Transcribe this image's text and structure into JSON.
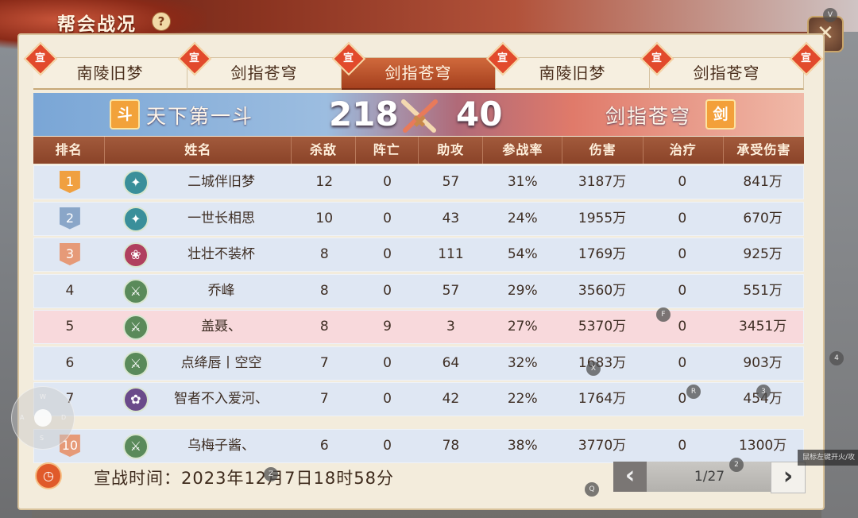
{
  "header": {
    "title": "帮会战况",
    "help_icon": "?",
    "close_icon": "✕"
  },
  "tabs": [
    {
      "label": "南陵旧梦",
      "badge": "宣",
      "active": false
    },
    {
      "label": "剑指苍穹",
      "badge": "宣",
      "active": false
    },
    {
      "label": "剑指苍穹",
      "badge": "宣",
      "active": true
    },
    {
      "label": "南陵旧梦",
      "badge": "宣",
      "active": false
    },
    {
      "label": "剑指苍穹",
      "badge": "宣",
      "active": false
    }
  ],
  "last_tab_badge": "宣",
  "score": {
    "left_icon": "斗",
    "left_name": "天下第一斗",
    "left_score": "218",
    "right_icon": "剑",
    "right_name": "剑指苍穹",
    "right_score": "40"
  },
  "table": {
    "headers": [
      "排名",
      "姓名",
      "杀敌",
      "阵亡",
      "助攻",
      "参战率",
      "伤害",
      "治疗",
      "承受伤害"
    ],
    "rows": [
      {
        "rank": "1",
        "cls": "teal",
        "name": "二城伴旧梦",
        "kills": "12",
        "deaths": "0",
        "assists": "57",
        "rate": "31%",
        "damage": "3187万",
        "heal": "0",
        "taken": "841万"
      },
      {
        "rank": "2",
        "cls": "teal",
        "name": "一世长相思",
        "kills": "10",
        "deaths": "0",
        "assists": "43",
        "rate": "24%",
        "damage": "1955万",
        "heal": "0",
        "taken": "670万"
      },
      {
        "rank": "3",
        "cls": "pink",
        "name": "壮壮不装杯",
        "kills": "8",
        "deaths": "0",
        "assists": "111",
        "rate": "54%",
        "damage": "1769万",
        "heal": "0",
        "taken": "925万"
      },
      {
        "rank": "4",
        "cls": "green",
        "name": "乔峰",
        "kills": "8",
        "deaths": "0",
        "assists": "57",
        "rate": "29%",
        "damage": "3560万",
        "heal": "0",
        "taken": "551万"
      },
      {
        "rank": "5",
        "cls": "green",
        "name": "盖聂、",
        "kills": "8",
        "deaths": "9",
        "assists": "3",
        "rate": "27%",
        "damage": "5370万",
        "heal": "0",
        "taken": "3451万"
      },
      {
        "rank": "6",
        "cls": "green",
        "name": "点绛唇丨空空",
        "kills": "7",
        "deaths": "0",
        "assists": "64",
        "rate": "32%",
        "damage": "1683万",
        "heal": "0",
        "taken": "903万"
      },
      {
        "rank": "7",
        "cls": "purple",
        "name": "智者不入爱河、",
        "kills": "7",
        "deaths": "0",
        "assists": "42",
        "rate": "22%",
        "damage": "1764万",
        "heal": "0",
        "taken": "454万"
      },
      {
        "rank": "10",
        "cls": "green",
        "name": "乌梅子酱、",
        "kills": "6",
        "deaths": "0",
        "assists": "78",
        "rate": "38%",
        "damage": "3770万",
        "heal": "0",
        "taken": "1300万"
      }
    ]
  },
  "footer": {
    "declare": "宣战时间：2023年12月7日18时58分",
    "page": "1/27",
    "prev": "‹",
    "next": "›"
  },
  "overlay": {
    "tooltip": "鼠标左键开火/攻",
    "hints": [
      "V",
      "F",
      "X",
      "R",
      "3",
      "4",
      "2",
      "Q",
      "Z"
    ],
    "joystick": [
      "W",
      "A",
      "S",
      "D"
    ]
  },
  "colors": {
    "accent": "#a5401e",
    "blue_side": "#7aa6d6",
    "red_side": "#e07a6a",
    "row": "#dfe7f3",
    "row_highlight": "#f8d9dc"
  }
}
